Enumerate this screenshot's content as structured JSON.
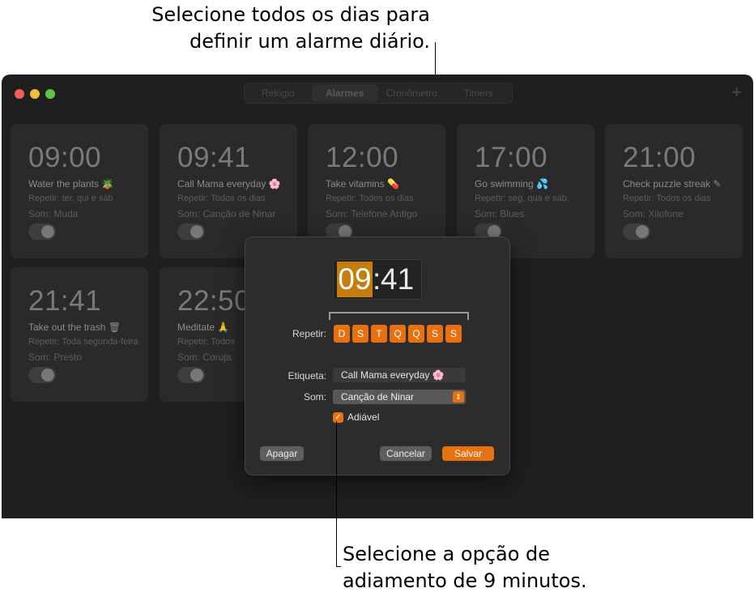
{
  "callouts": {
    "top_line1": "Selecione todos os dias para",
    "top_line2": "definir um alarme diário.",
    "bottom_line1": "Selecione a opção de",
    "bottom_line2": "adiamento de 9 minutos."
  },
  "toolbar": {
    "tabs": [
      "Relógio",
      "Alarmes",
      "Cronômetro",
      "Timers"
    ],
    "active_tab": "Alarmes",
    "add_icon": "+"
  },
  "alarms": [
    {
      "time": "09:00",
      "label": "Water the plants 🪴",
      "repeat": "Repetir: ter, qui e sáb",
      "sound": "Som: Muda"
    },
    {
      "time": "09:41",
      "label": "Call Mama everyday 🌸",
      "repeat": "Repetir: Todos os dias",
      "sound": "Som: Canção de Ninar"
    },
    {
      "time": "12:00",
      "label": "Take vitamins 💊",
      "repeat": "Repetir: Todos os dias",
      "sound": "Som: Telefone Antigo"
    },
    {
      "time": "17:00",
      "label": "Go swimming 💦",
      "repeat": "Repetir: seg, qua e sáb.",
      "sound": "Som: Blues"
    },
    {
      "time": "21:00",
      "label": "Check puzzle streak ✎",
      "repeat": "Repetir: Todos os dias",
      "sound": "Som: Xilofone"
    },
    {
      "time": "21:41",
      "label": "Take out the trash 🗑",
      "repeat": "Repetir: Toda segunda-feira",
      "sound": "Som: Presto"
    },
    {
      "time": "22:50",
      "label": "Meditate 🙏",
      "repeat": "Repetir: Todos",
      "sound": "Som: Coruja"
    }
  ],
  "dialog": {
    "hour": "09",
    "colon": ":",
    "minute": "41",
    "repeat_label": "Repetir:",
    "days": [
      "D",
      "S",
      "T",
      "Q",
      "Q",
      "S",
      "S"
    ],
    "label_label": "Etiqueta:",
    "label_value": "Call Mama everyday 🌸",
    "sound_label": "Som:",
    "sound_value": "Canção de Ninar",
    "snooze_label": "Adiável",
    "snooze_checked": true,
    "delete_button": "Apagar",
    "cancel_button": "Cancelar",
    "save_button": "Salvar"
  },
  "colors": {
    "accent": "#e8700e",
    "window_bg": "#1f1f1f",
    "card_bg": "#2a2a2a"
  }
}
